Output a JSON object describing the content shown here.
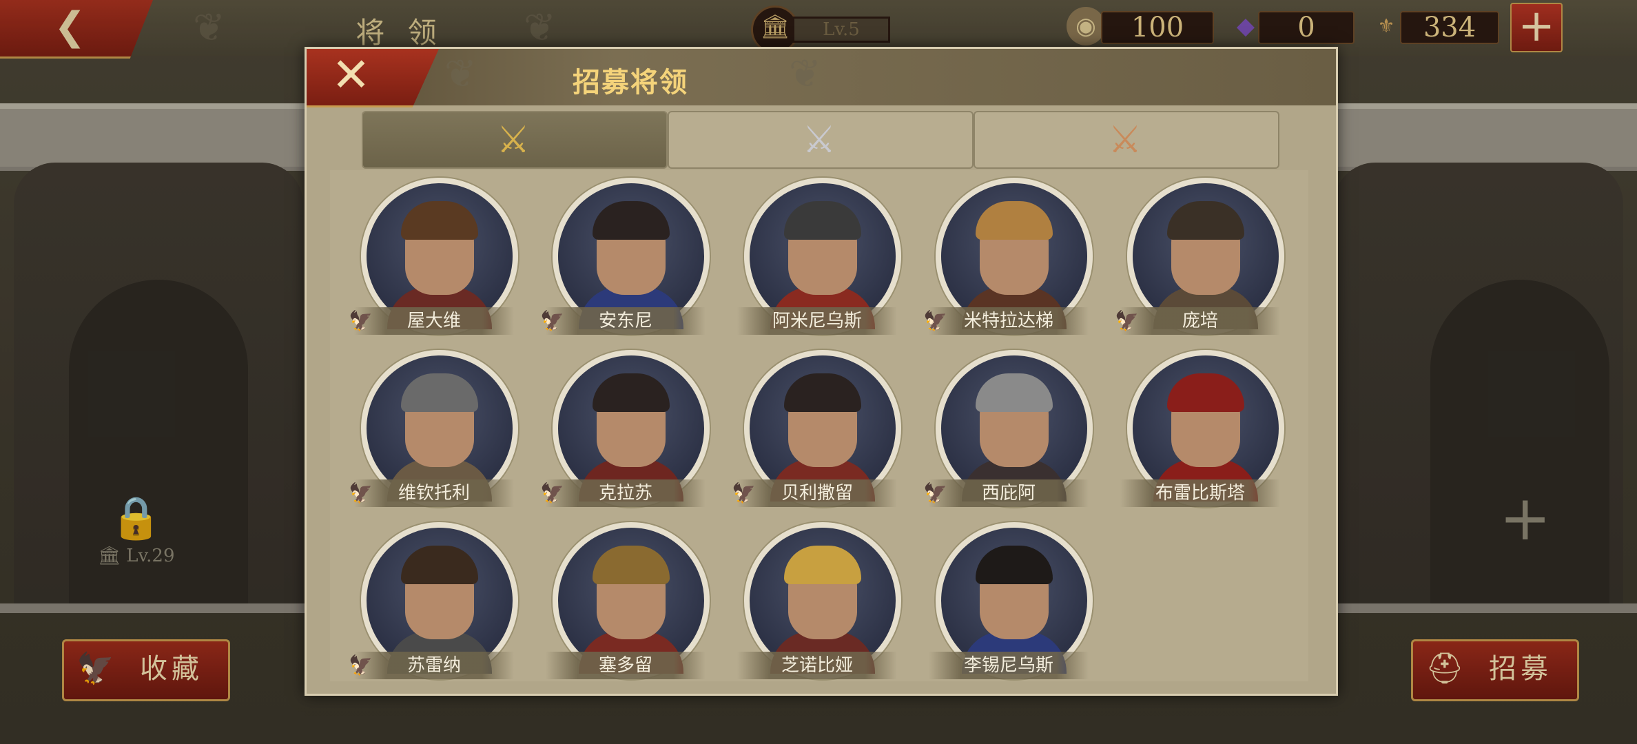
{
  "topbar": {
    "back_icon": "back-chevron-icon",
    "title": "将 领",
    "level_label": "Lv.5",
    "resources": [
      {
        "name": "coin",
        "value": "100",
        "color": "#e0b660"
      },
      {
        "name": "gem",
        "value": "0",
        "color": "#7a4fb5"
      },
      {
        "name": "spqr",
        "value": "334",
        "color": "#d2a45a"
      }
    ],
    "add_icon": "+"
  },
  "background": {
    "lock_level": "Lv.29",
    "favorites_label": "收藏",
    "recruit_label": "招募"
  },
  "modal": {
    "title": "招募将领",
    "close_icon": "✕",
    "tabs": [
      {
        "name": "gold",
        "color": "#d8b24c",
        "active": true
      },
      {
        "name": "silver",
        "color": "#c9c9cf",
        "active": false
      },
      {
        "name": "bronze",
        "color": "#c98a5a",
        "active": false
      }
    ],
    "generals": [
      {
        "name": "屋大维",
        "badge": true
      },
      {
        "name": "安东尼",
        "badge": true
      },
      {
        "name": "阿米尼乌斯",
        "badge": false
      },
      {
        "name": "米特拉达梯",
        "badge": true
      },
      {
        "name": "庞培",
        "badge": true
      },
      {
        "name": "维钦托利",
        "badge": true
      },
      {
        "name": "克拉苏",
        "badge": true
      },
      {
        "name": "贝利撒留",
        "badge": true
      },
      {
        "name": "西庇阿",
        "badge": true
      },
      {
        "name": "布雷比斯塔",
        "badge": false
      },
      {
        "name": "苏雷纳",
        "badge": true
      },
      {
        "name": "塞多留",
        "badge": false
      },
      {
        "name": "芝诺比娅",
        "badge": false
      },
      {
        "name": "李锡尼乌斯",
        "badge": false
      }
    ]
  }
}
